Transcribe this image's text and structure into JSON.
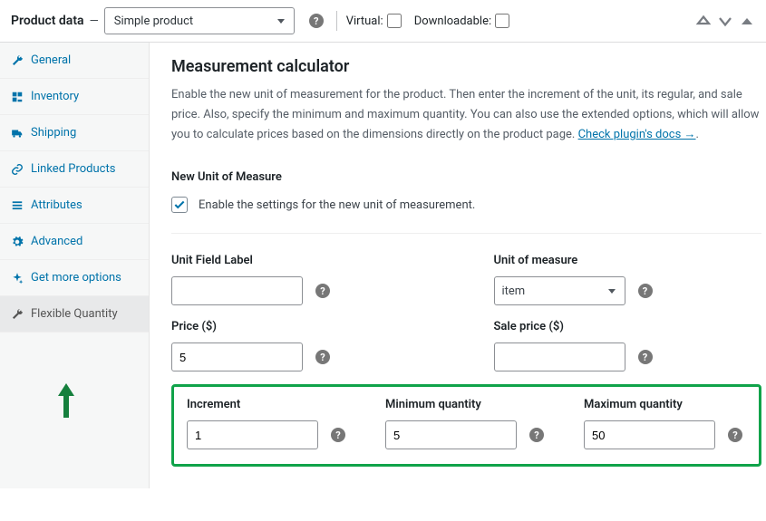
{
  "header": {
    "title": "Product data",
    "dash": "—",
    "product_type": "Simple product",
    "virtual_label": "Virtual:",
    "downloadable_label": "Downloadable:"
  },
  "sidebar": {
    "tabs": [
      {
        "label": "General",
        "icon": "wrench"
      },
      {
        "label": "Inventory",
        "icon": "inventory"
      },
      {
        "label": "Shipping",
        "icon": "truck"
      },
      {
        "label": "Linked Products",
        "icon": "link"
      },
      {
        "label": "Attributes",
        "icon": "list"
      },
      {
        "label": "Advanced",
        "icon": "gear"
      },
      {
        "label": "Get more options",
        "icon": "sparkle"
      },
      {
        "label": "Flexible Quantity",
        "icon": "wrench"
      }
    ]
  },
  "content": {
    "heading": "Measurement calculator",
    "description_before": "Enable the new unit of measurement for the product. Then enter the increment of the unit, its regular, and sale price. Also, specify the minimum and maximum quantity. You can also use the extended options, which will allow you to calculate prices based on the dimensions directly on the product page. ",
    "docs_link": "Check plugin's docs →",
    "docs_after": ".",
    "section_new_unit": "New Unit of Measure",
    "enable_label": "Enable the settings for the new unit of measurement.",
    "fields": {
      "unit_field_label": {
        "label": "Unit Field Label",
        "value": ""
      },
      "unit_of_measure": {
        "label": "Unit of measure",
        "value": "item"
      },
      "price": {
        "label": "Price ($)",
        "value": "5"
      },
      "sale_price": {
        "label": "Sale price ($)",
        "value": ""
      },
      "increment": {
        "label": "Increment",
        "value": "1"
      },
      "min_qty": {
        "label": "Minimum quantity",
        "value": "5"
      },
      "max_qty": {
        "label": "Maximum quantity",
        "value": "50"
      }
    }
  }
}
